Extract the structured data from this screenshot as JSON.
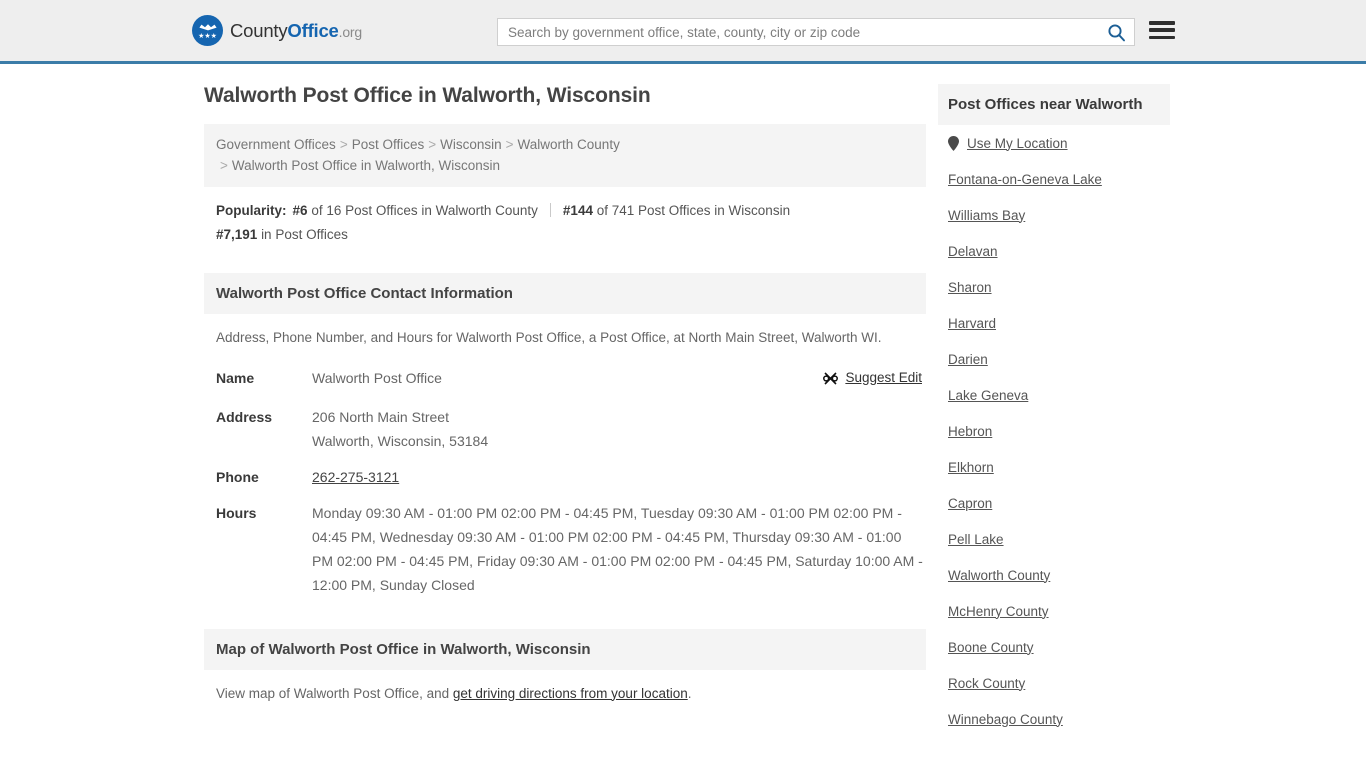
{
  "header": {
    "logo": {
      "part1": "County",
      "part2": "Office",
      "part3": ".org",
      "icon": "eagle-seal-icon",
      "stars": "★★★"
    },
    "search": {
      "placeholder": "Search by government office, state, county, city or zip code",
      "value": "",
      "search_icon": "search-icon"
    },
    "menu_icon": "hamburger-menu-icon",
    "accent_color": "#3b7ca8"
  },
  "main": {
    "page_title": "Walworth Post Office in Walworth, Wisconsin",
    "breadcrumb": {
      "items": [
        "Government Offices",
        "Post Offices",
        "Wisconsin",
        "Walworth County",
        "Walworth Post Office in Walworth, Wisconsin"
      ],
      "separator": ">"
    },
    "popularity": {
      "label": "Popularity:",
      "rank1_num": "#6",
      "rank1_text": "of 16 Post Offices in Walworth County",
      "rank2_num": "#144",
      "rank2_text": "of 741 Post Offices in Wisconsin",
      "rank3_num": "#7,191",
      "rank3_text": "in Post Offices"
    },
    "contact": {
      "heading": "Walworth Post Office Contact Information",
      "description": "Address, Phone Number, and Hours for Walworth Post Office, a Post Office, at North Main Street, Walworth WI.",
      "suggest_edit": "Suggest Edit",
      "suggest_edit_icon": "edit-pen-icon",
      "rows": [
        {
          "label": "Name",
          "value": "Walworth Post Office"
        },
        {
          "label": "Address",
          "value": "206 North Main Street",
          "value2": "Walworth, Wisconsin, 53184"
        },
        {
          "label": "Phone",
          "value": "262-275-3121",
          "link": true
        },
        {
          "label": "Hours",
          "value": "Monday 09:30 AM - 01:00 PM 02:00 PM - 04:45 PM, Tuesday 09:30 AM - 01:00 PM 02:00 PM - 04:45 PM, Wednesday 09:30 AM - 01:00 PM 02:00 PM - 04:45 PM, Thursday 09:30 AM - 01:00 PM 02:00 PM - 04:45 PM, Friday 09:30 AM - 01:00 PM 02:00 PM - 04:45 PM, Saturday 10:00 AM - 12:00 PM, Sunday Closed"
        }
      ]
    },
    "map": {
      "heading": "Map of Walworth Post Office in Walworth, Wisconsin",
      "note_before": "View map of Walworth Post Office, and ",
      "note_link": "get driving directions from your location",
      "note_after": "."
    }
  },
  "sidebar": {
    "heading": "Post Offices near Walworth",
    "use_my_location": "Use My Location",
    "pin_icon": "map-pin-icon",
    "items": [
      "Fontana-on-Geneva Lake",
      "Williams Bay",
      "Delavan",
      "Sharon",
      "Harvard",
      "Darien",
      "Lake Geneva",
      "Hebron",
      "Elkhorn",
      "Capron",
      "Pell Lake",
      "Walworth County",
      "McHenry County",
      "Boone County",
      "Rock County",
      "Winnebago County"
    ]
  }
}
